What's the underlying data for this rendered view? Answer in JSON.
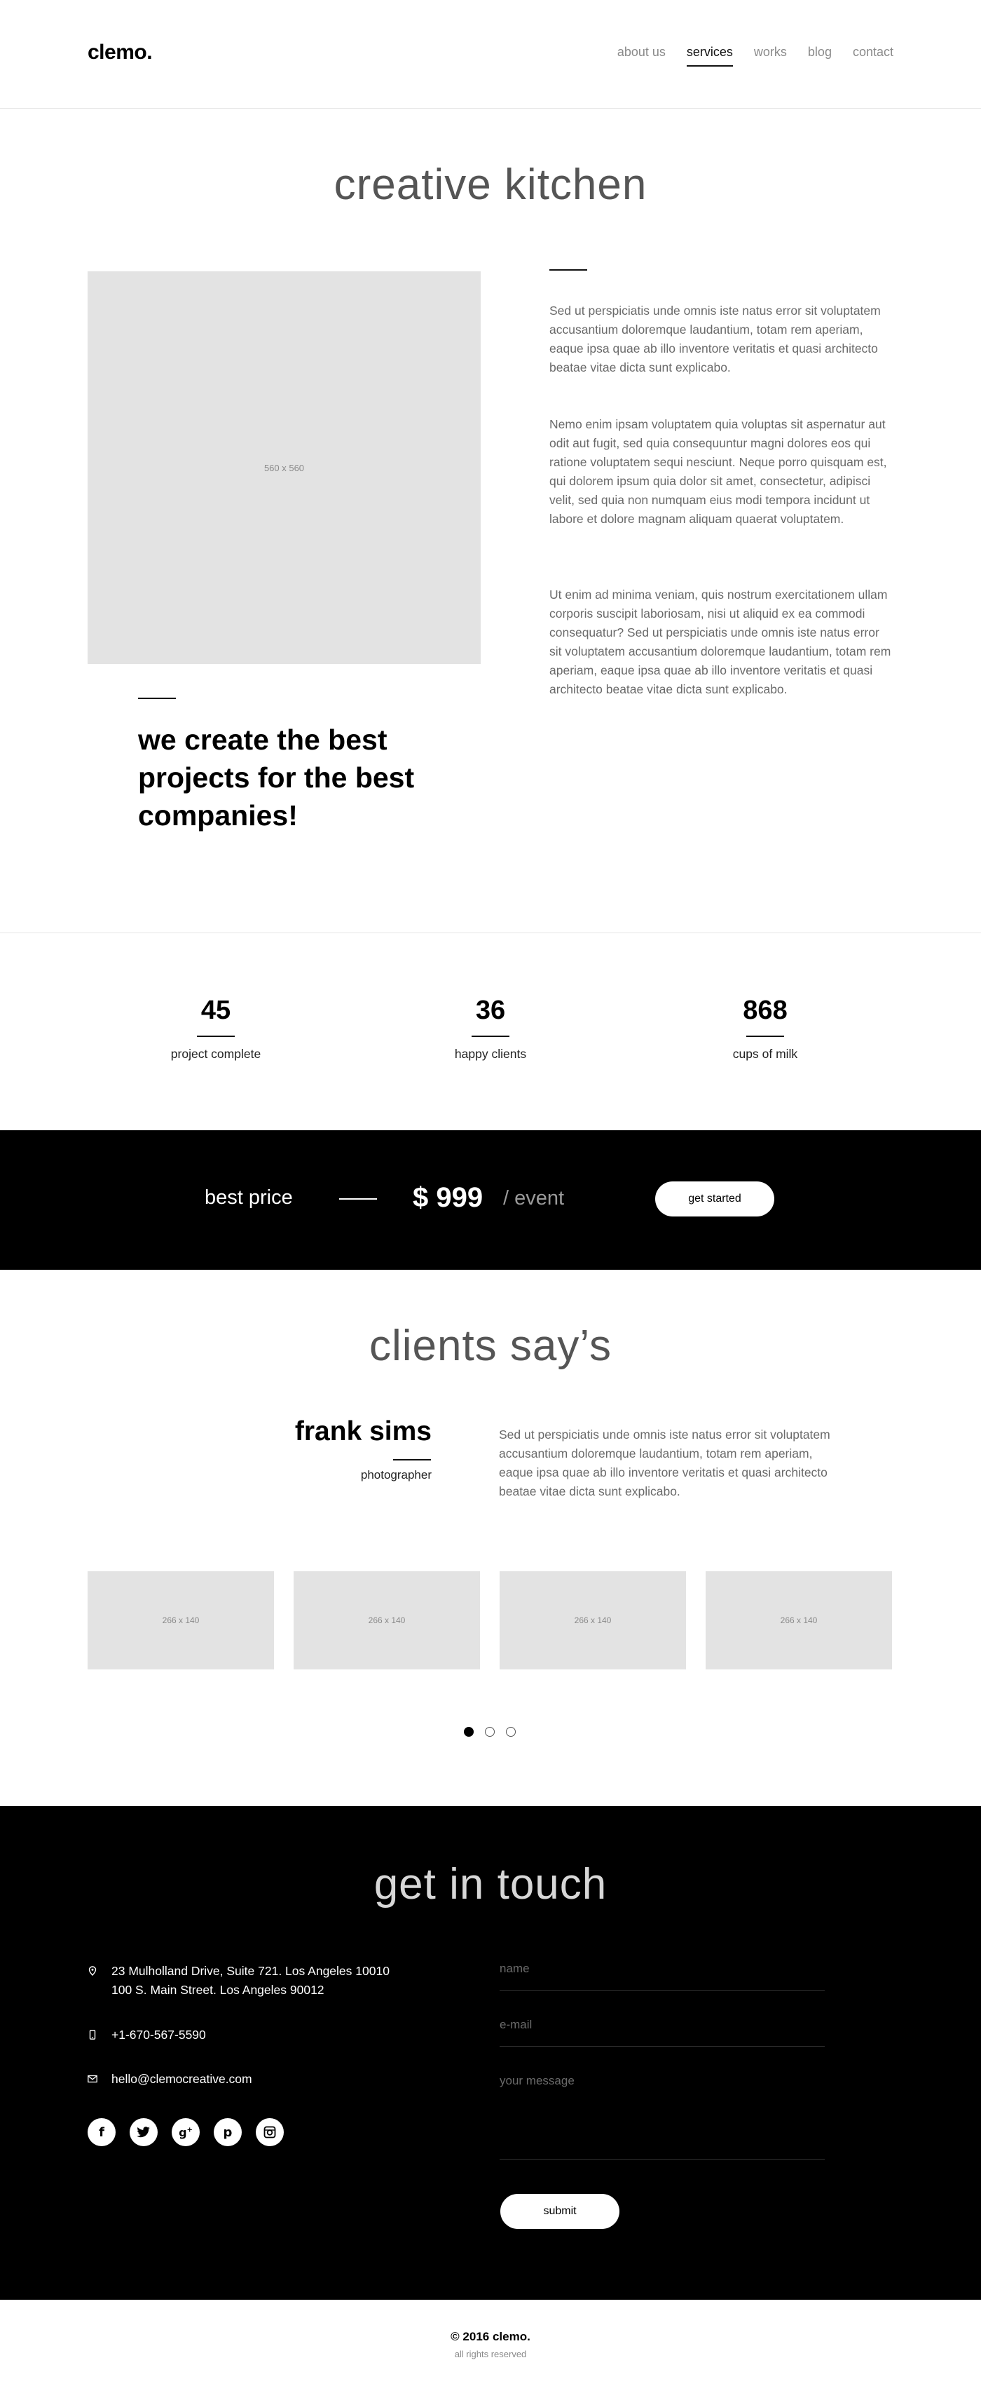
{
  "header": {
    "logo": "clemo.",
    "nav": [
      "about us",
      "services",
      "works",
      "blog",
      "contact"
    ],
    "active_nav": "services"
  },
  "about": {
    "title": "creative kitchen",
    "image_label": "560 x 560",
    "paragraphs": [
      "Sed ut perspiciatis unde omnis iste natus error sit voluptatem accusantium doloremque laudantium, totam rem aperiam, eaque ipsa quae ab illo inventore veritatis et quasi architecto beatae vitae dicta sunt explicabo.",
      "Nemo enim ipsam voluptatem quia voluptas sit aspernatur aut odit aut fugit, sed quia consequuntur magni dolores eos qui ratione voluptatem sequi nesciunt. Neque porro quisquam est, qui dolorem ipsum quia dolor sit amet, consectetur, adipisci velit, sed quia non numquam eius modi tempora incidunt ut labore et dolore magnam aliquam quaerat voluptatem.",
      "Ut enim ad minima veniam, quis nostrum exercitationem ullam corporis suscipit laboriosam, nisi ut aliquid ex ea commodi consequatur? Sed ut perspiciatis unde omnis iste natus error sit voluptatem accusantium doloremque laudantium, totam rem aperiam, eaque ipsa quae ab illo inventore veritatis et quasi architecto beatae vitae dicta sunt explicabo."
    ],
    "slogan": "we create the best projects for the best companies!"
  },
  "stats": [
    {
      "value": "45",
      "label": "project complete"
    },
    {
      "value": "36",
      "label": "happy clients"
    },
    {
      "value": "868",
      "label": "cups of milk"
    }
  ],
  "pricing": {
    "label": "best price",
    "price": "$ 999",
    "per": "/ event",
    "button": "get started"
  },
  "testimonials": {
    "title": "clients say’s",
    "name": "frank sims",
    "role": "photographer",
    "quote": "Sed ut perspiciatis unde omnis iste natus error sit voluptatem accusantium doloremque laudantium, totam rem aperiam, eaque ipsa quae ab illo inventore veritatis et quasi architecto beatae vitae dicta sunt explicabo.",
    "logos": [
      "266 x 140",
      "266 x 140",
      "266 x 140",
      "266 x 140"
    ],
    "active_dot": 1,
    "dot_count": 3
  },
  "contact": {
    "title": "get in touch",
    "address_line1": "23 Mulholland Drive, Suite 721. Los Angeles 10010",
    "address_line2": "100 S. Main Street. Los Angeles 90012",
    "phone": "+1-670-567-5590",
    "email": "hello@clemocreative.com",
    "socials": [
      "facebook-icon",
      "twitter-icon",
      "google-plus-icon",
      "pinterest-icon",
      "instagram-icon"
    ],
    "form": {
      "name_placeholder": "name",
      "email_placeholder": "e-mail",
      "message_placeholder": "your message",
      "submit": "submit"
    }
  },
  "footer": {
    "copyright": "© 2016 clemo.",
    "rights": "all rights reserved"
  },
  "colors": {
    "accent": "#000000",
    "band_bg": "#000000",
    "placeholder_bg": "#e3e3e3",
    "body_text": "#6a6a6a"
  }
}
